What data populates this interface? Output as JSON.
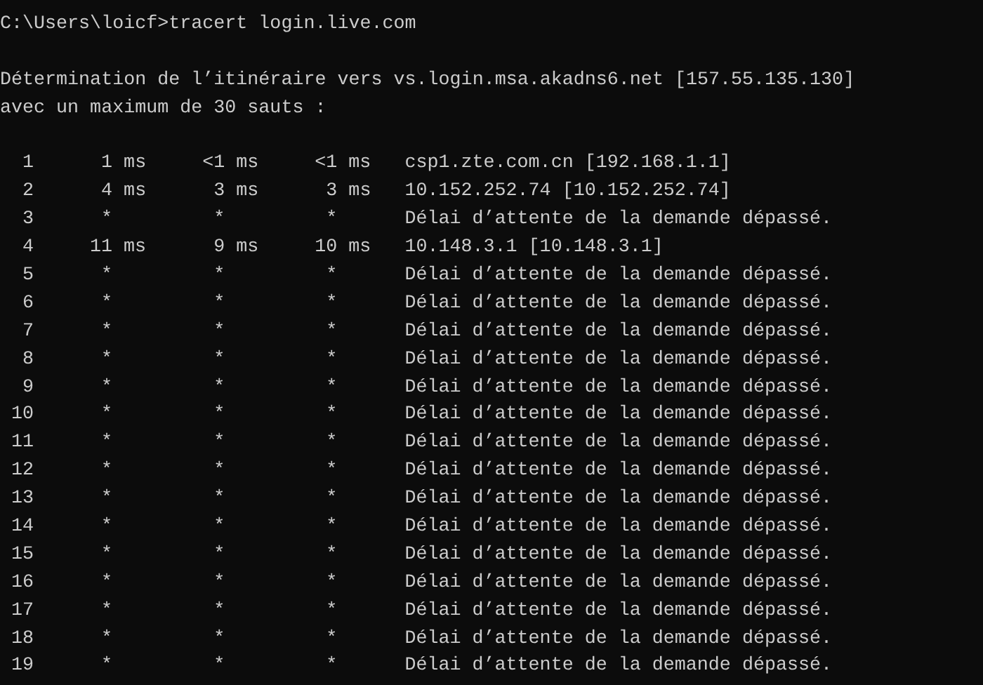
{
  "command": {
    "prompt": "C:\\Users\\loicf>",
    "input": "tracert login.live.com"
  },
  "header": [
    "Détermination de l’itinéraire vers vs.login.msa.akadns6.net [157.55.135.130]",
    "avec un maximum de 30 sauts :"
  ],
  "hops": [
    {
      "hop": "1",
      "times": [
        "1 ms",
        "<1 ms",
        "<1 ms"
      ],
      "host": "csp1.zte.com.cn [192.168.1.1]"
    },
    {
      "hop": "2",
      "times": [
        "4 ms",
        "3 ms",
        "3 ms"
      ],
      "host": "10.152.252.74 [10.152.252.74]"
    },
    {
      "hop": "3",
      "times": [
        "*",
        "*",
        "*"
      ],
      "host": "Délai d’attente de la demande dépassé."
    },
    {
      "hop": "4",
      "times": [
        "11 ms",
        "9 ms",
        "10 ms"
      ],
      "host": "10.148.3.1 [10.148.3.1]"
    },
    {
      "hop": "5",
      "times": [
        "*",
        "*",
        "*"
      ],
      "host": "Délai d’attente de la demande dépassé."
    },
    {
      "hop": "6",
      "times": [
        "*",
        "*",
        "*"
      ],
      "host": "Délai d’attente de la demande dépassé."
    },
    {
      "hop": "7",
      "times": [
        "*",
        "*",
        "*"
      ],
      "host": "Délai d’attente de la demande dépassé."
    },
    {
      "hop": "8",
      "times": [
        "*",
        "*",
        "*"
      ],
      "host": "Délai d’attente de la demande dépassé."
    },
    {
      "hop": "9",
      "times": [
        "*",
        "*",
        "*"
      ],
      "host": "Délai d’attente de la demande dépassé."
    },
    {
      "hop": "10",
      "times": [
        "*",
        "*",
        "*"
      ],
      "host": "Délai d’attente de la demande dépassé."
    },
    {
      "hop": "11",
      "times": [
        "*",
        "*",
        "*"
      ],
      "host": "Délai d’attente de la demande dépassé."
    },
    {
      "hop": "12",
      "times": [
        "*",
        "*",
        "*"
      ],
      "host": "Délai d’attente de la demande dépassé."
    },
    {
      "hop": "13",
      "times": [
        "*",
        "*",
        "*"
      ],
      "host": "Délai d’attente de la demande dépassé."
    },
    {
      "hop": "14",
      "times": [
        "*",
        "*",
        "*"
      ],
      "host": "Délai d’attente de la demande dépassé."
    },
    {
      "hop": "15",
      "times": [
        "*",
        "*",
        "*"
      ],
      "host": "Délai d’attente de la demande dépassé."
    },
    {
      "hop": "16",
      "times": [
        "*",
        "*",
        "*"
      ],
      "host": "Délai d’attente de la demande dépassé."
    },
    {
      "hop": "17",
      "times": [
        "*",
        "*",
        "*"
      ],
      "host": "Délai d’attente de la demande dépassé."
    },
    {
      "hop": "18",
      "times": [
        "*",
        "*",
        "*"
      ],
      "host": "Délai d’attente de la demande dépassé."
    },
    {
      "hop": "19",
      "times": [
        "*",
        "*",
        "*"
      ],
      "host": "Délai d’attente de la demande dépassé."
    }
  ]
}
